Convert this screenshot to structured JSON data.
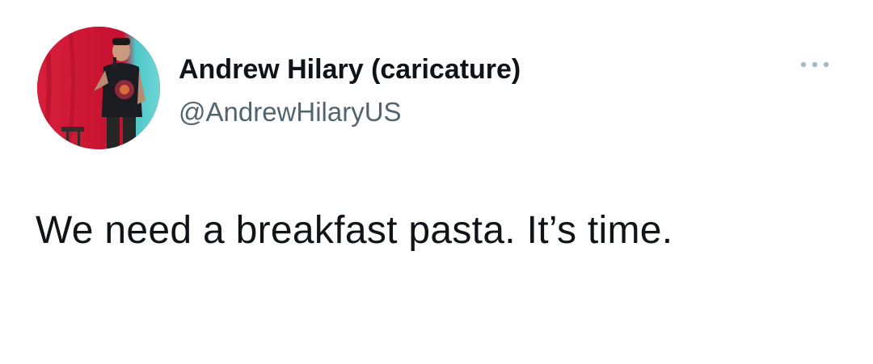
{
  "author": {
    "display_name": "Andrew Hilary (caricature)",
    "handle": "@AndrewHilaryUS"
  },
  "tweet": {
    "text": "We need a breakfast pasta. It’s time."
  },
  "icons": {
    "avatar": "profile-photo",
    "more": "more-options-icon"
  },
  "colors": {
    "text_primary": "#0f1419",
    "text_secondary": "#536471",
    "more_icon": "#aab8c2",
    "background": "#ffffff"
  }
}
